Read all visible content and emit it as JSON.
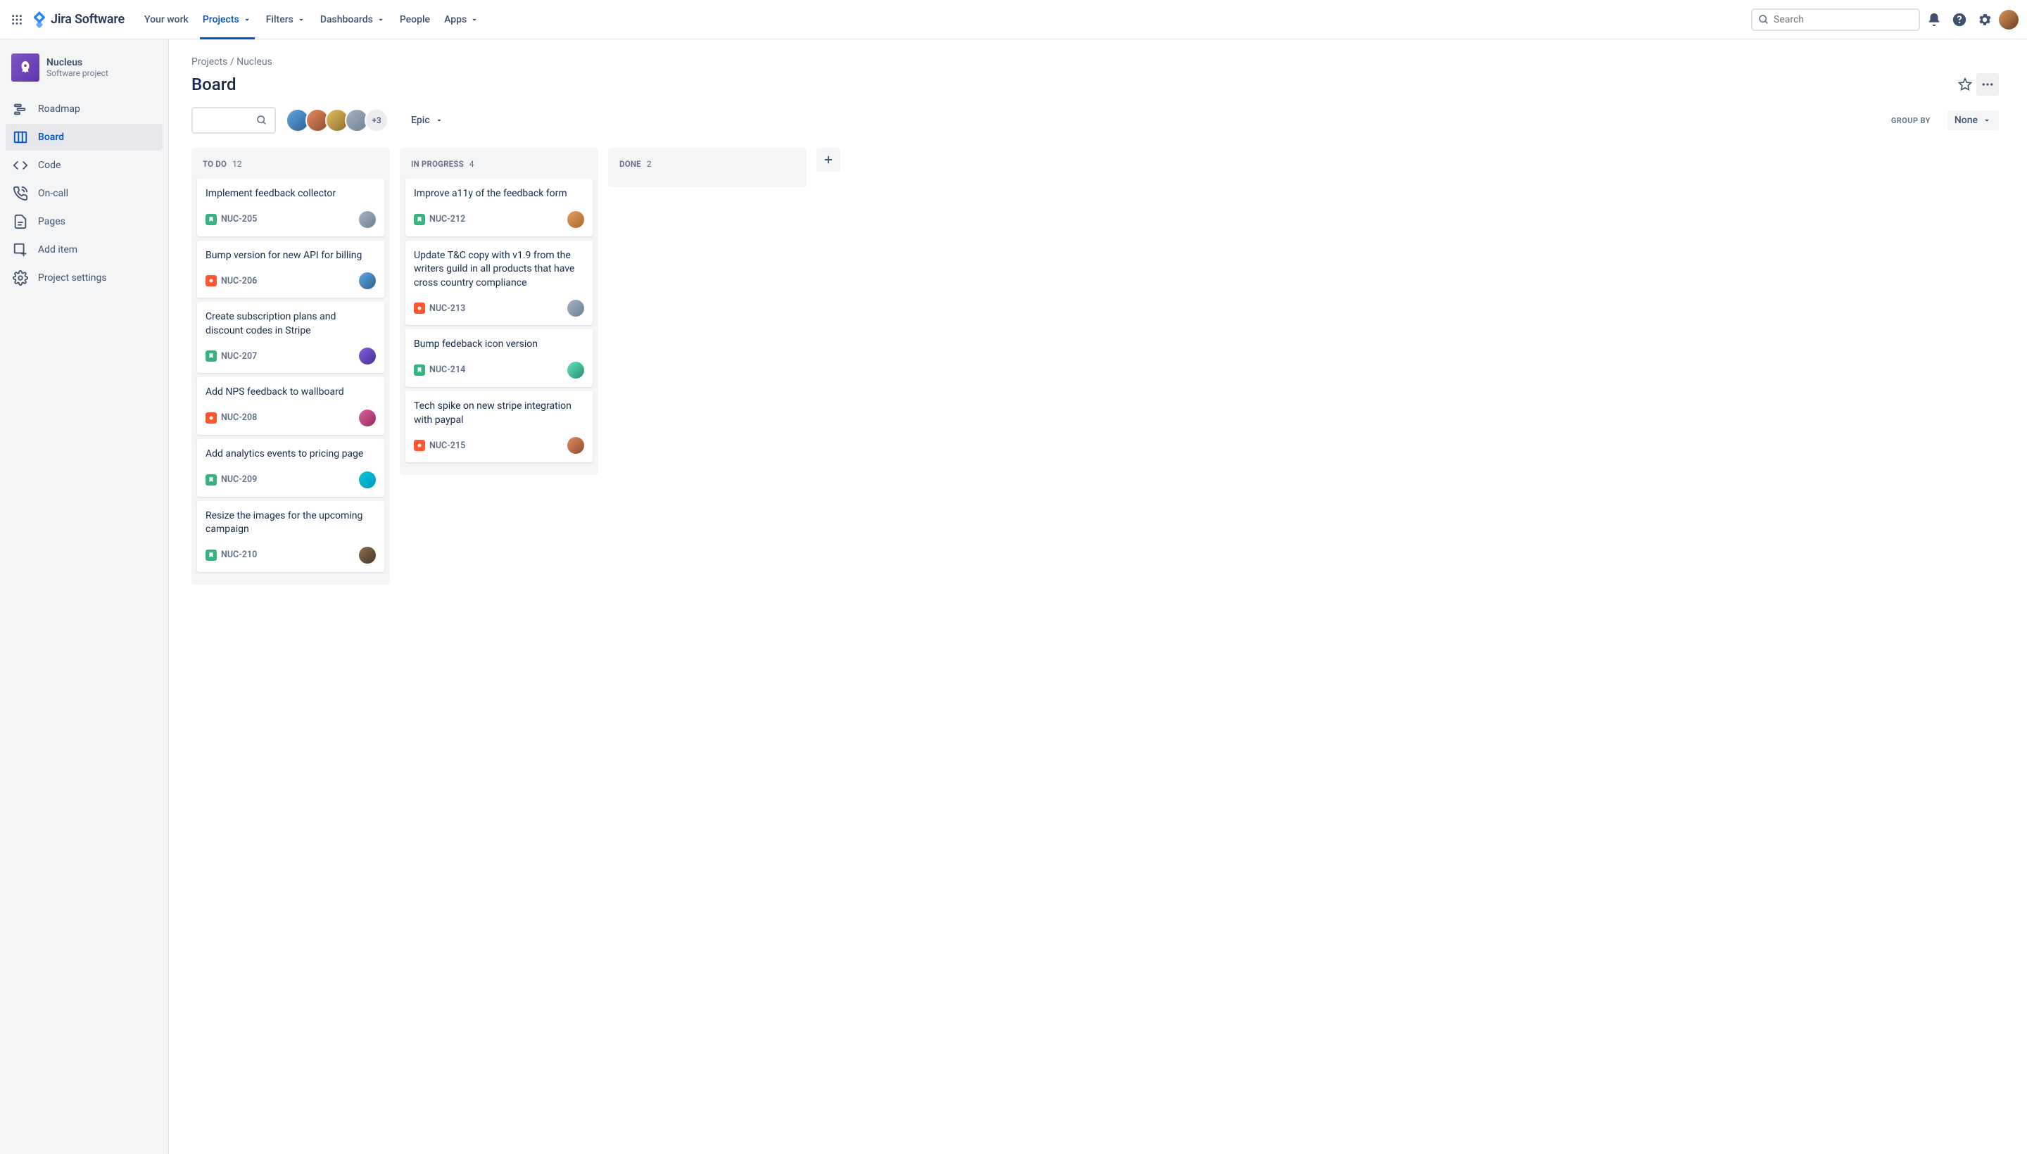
{
  "app": {
    "logo_text": "Jira Software",
    "search_placeholder": "Search"
  },
  "nav": {
    "your_work": "Your work",
    "projects": "Projects",
    "filters": "Filters",
    "dashboards": "Dashboards",
    "people": "People",
    "apps": "Apps"
  },
  "sidebar": {
    "project_name": "Nucleus",
    "project_type": "Software project",
    "items": {
      "roadmap": "Roadmap",
      "board": "Board",
      "code": "Code",
      "oncall": "On-call",
      "pages": "Pages",
      "additem": "Add item",
      "settings": "Project settings"
    }
  },
  "breadcrumb": {
    "projects": "Projects",
    "sep": " / ",
    "current": "Nucleus"
  },
  "page": {
    "title": "Board",
    "epic_label": "Epic",
    "groupby_label": "GROUP BY",
    "groupby_value": "None",
    "assignee_overflow": "+3"
  },
  "columns": {
    "todo": {
      "name": "TO DO",
      "count": "12"
    },
    "inprogress": {
      "name": "IN PROGRESS",
      "count": "4"
    },
    "done": {
      "name": "DONE",
      "count": "2"
    }
  },
  "cards": {
    "todo": [
      {
        "title": "Implement feedback collector",
        "key": "NUC-205",
        "type": "story",
        "av": "av-1"
      },
      {
        "title": "Bump version for new API for billing",
        "key": "NUC-206",
        "type": "bug",
        "av": "av-4"
      },
      {
        "title": "Create subscription plans and discount codes in Stripe",
        "key": "NUC-207",
        "type": "story",
        "av": "av-6"
      },
      {
        "title": "Add NPS feedback to wallboard",
        "key": "NUC-208",
        "type": "bug",
        "av": "av-5"
      },
      {
        "title": "Add analytics events to pricing page",
        "key": "NUC-209",
        "type": "story",
        "av": "av-8"
      },
      {
        "title": "Resize the images for the upcoming campaign",
        "key": "NUC-210",
        "type": "story",
        "av": "av-9"
      }
    ],
    "inprogress": [
      {
        "title": "Improve a11y of the feedback form",
        "key": "NUC-212",
        "type": "story",
        "av": "av-10"
      },
      {
        "title": "Update T&C copy with v1.9 from the writers guild in all products that have cross country compliance",
        "key": "NUC-213",
        "type": "bug",
        "av": "av-1"
      },
      {
        "title": "Bump fedeback icon version",
        "key": "NUC-214",
        "type": "story",
        "av": "av-7"
      },
      {
        "title": "Tech spike on new stripe integration with paypal",
        "key": "NUC-215",
        "type": "bug",
        "av": "av-2"
      }
    ]
  }
}
